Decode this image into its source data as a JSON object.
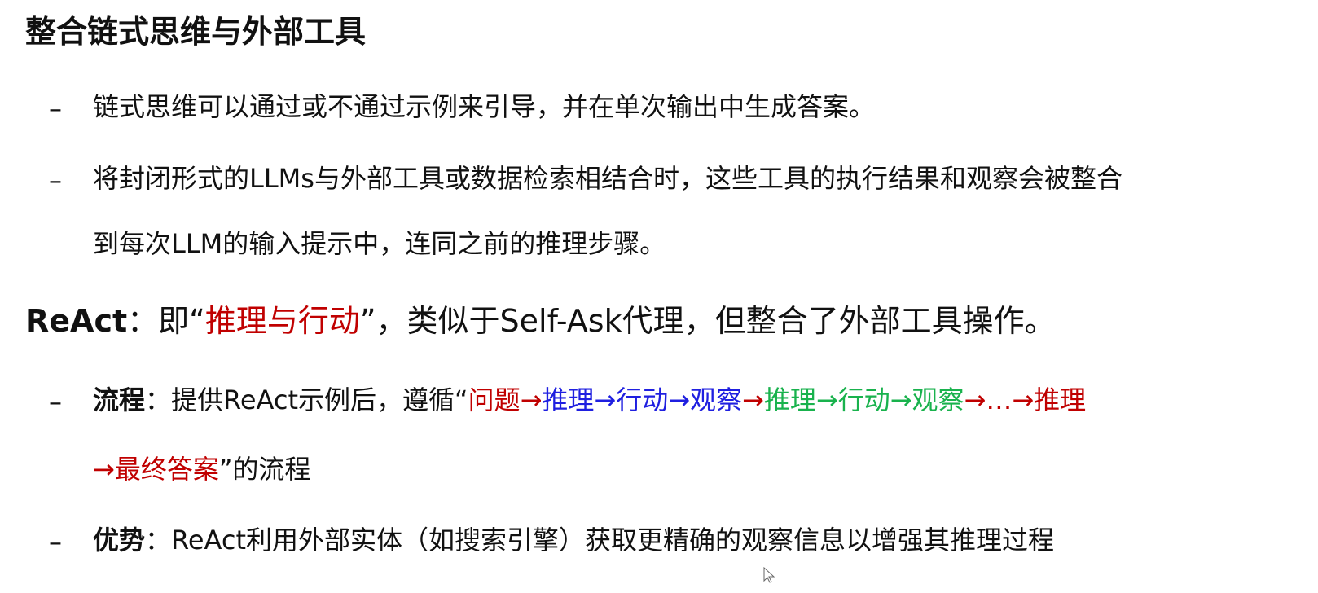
{
  "slide": {
    "title": "整合链式思维与外部工具",
    "bullets_1": [
      {
        "text": "链式思维可以通过或不通过示例来引导，并在单次输出中生成答案。"
      },
      {
        "text_line_1": "将封闭形式的LLMs与外部工具或数据检索相结合时，这些工具的执行结果和观察会被整合",
        "text_line_2": "到每次LLM的输入提示中，连同之前的推理步骤。"
      }
    ],
    "react": {
      "label": "ReAct",
      "sep": "：即",
      "quote_open": "“",
      "highlight": "推理与行动",
      "quote_close": "”",
      "rest": "，类似于Self-Ask代理，但整合了外部工具操作。"
    },
    "bullets_2": {
      "process": {
        "label": "流程",
        "sep": "：",
        "prefix": "提供ReAct示例后，遵循“",
        "seg_red_1": "问题→",
        "seg_blue": "推理→行动→观察",
        "seg_red_2": "→",
        "seg_green": "推理→行动→观察",
        "seg_red_3": "→…→推理",
        "seg_red_4": "→最终答案",
        "suffix": "”的流程"
      },
      "advantage": {
        "label": "优势",
        "sep": "：",
        "text": "ReAct利用外部实体（如搜索引擎）获取更精确的观察信息以增强其推理过程"
      }
    },
    "dash": "–"
  }
}
